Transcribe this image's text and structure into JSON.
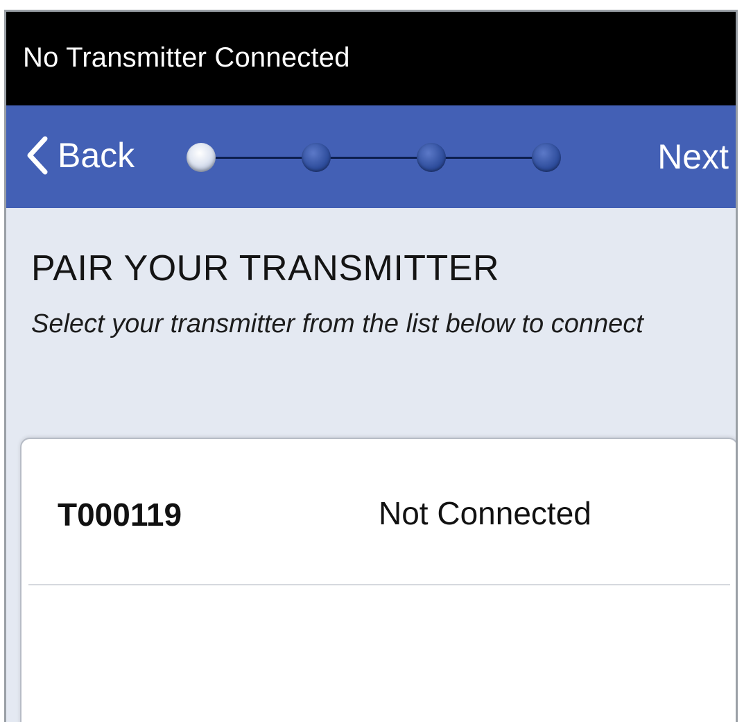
{
  "status_bar": {
    "text": "No Transmitter Connected"
  },
  "nav": {
    "back_label": "Back",
    "next_label": "Next",
    "steps_total": 4,
    "current_step": 1
  },
  "page": {
    "title": "PAIR YOUR TRANSMITTER",
    "subtitle": "Select your transmitter from the list below to connect"
  },
  "transmitters": [
    {
      "id": "T000119",
      "status": "Not Connected"
    }
  ],
  "colors": {
    "status_bar_bg": "#000000",
    "nav_bar_bg": "#4360b5",
    "content_bg": "#e4e9f2"
  }
}
